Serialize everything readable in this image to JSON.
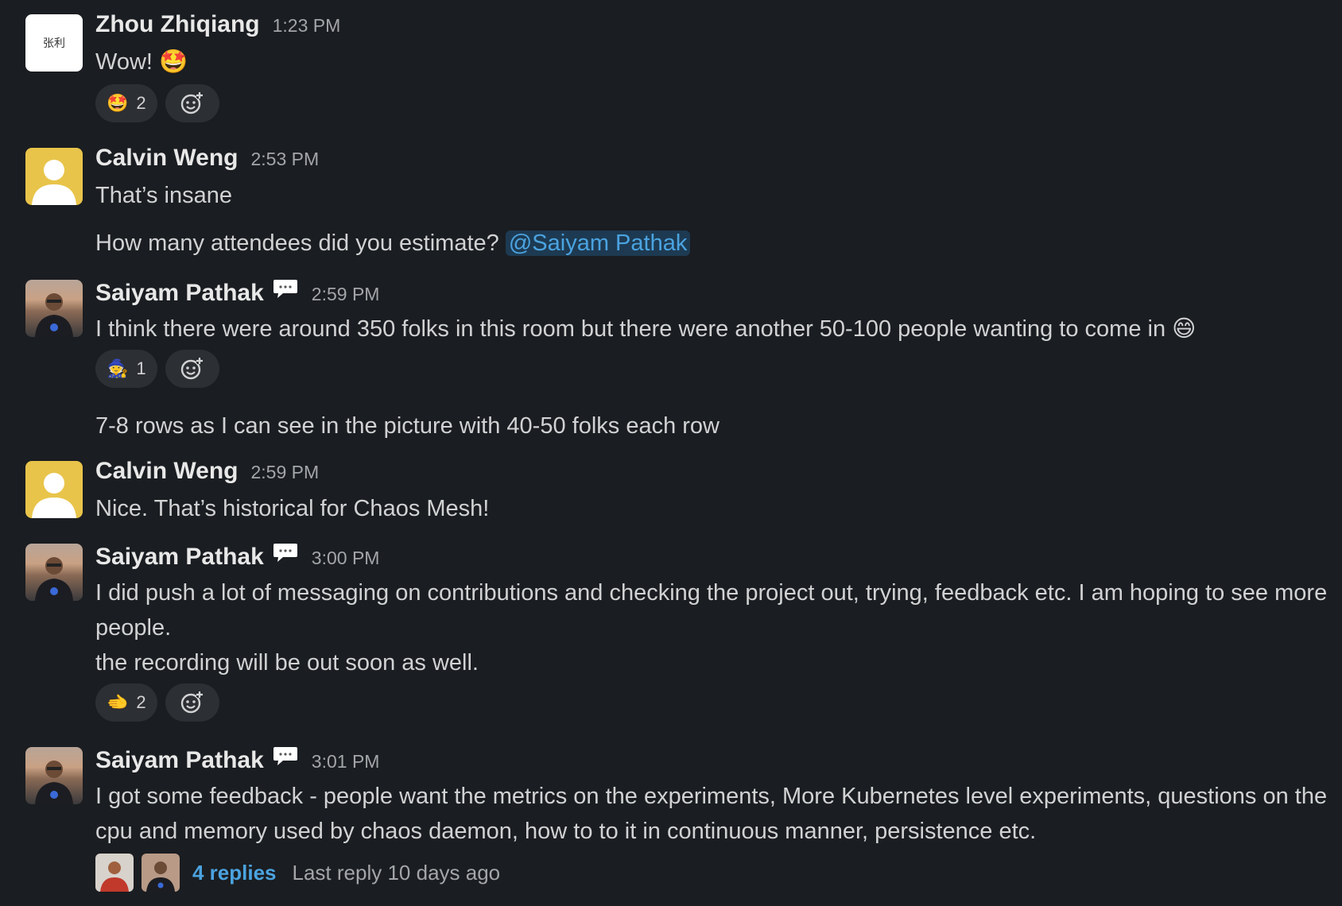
{
  "messages": [
    {
      "author": "Zhou Zhiqiang",
      "time": "1:23 PM",
      "text": "Wow! 🤩",
      "avatar_text": "张利",
      "reactions": [
        {
          "emoji": "🤩",
          "count": "2"
        }
      ]
    },
    {
      "author": "Calvin Weng",
      "time": "2:53 PM",
      "text": "That’s insane",
      "text2": "How many attendees did you estimate?",
      "mention": "@Saiyam Pathak"
    },
    {
      "author": "Saiyam Pathak",
      "time": "2:59 PM",
      "text": "I think there were around 350 folks in this room but there were another 50-100 people wanting to come in 😄",
      "reactions": [
        {
          "emoji": "🧙",
          "count": "1"
        }
      ],
      "text2": "7-8 rows as I can see in the picture with 40-50 folks each row"
    },
    {
      "author": "Calvin Weng",
      "time": "2:59 PM",
      "text": "Nice. That’s historical for Chaos Mesh!"
    },
    {
      "author": "Saiyam Pathak",
      "time": "3:00 PM",
      "text": "I did push a lot of messaging on contributions and checking the project out, trying, feedback etc. I am hoping to see more people.",
      "text2": "the recording will be out soon as well.",
      "reactions": [
        {
          "emoji": "🫲",
          "count": "2"
        }
      ]
    },
    {
      "author": "Saiyam Pathak",
      "time": "3:01 PM",
      "text": "I got some feedback - people want the metrics on the experiments, More Kubernetes level experiments, questions on the cpu and memory used by chaos daemon, how to to it in continuous manner, persistence etc.",
      "thread": {
        "replies": "4 replies",
        "last": "Last reply 10 days ago"
      }
    }
  ],
  "colors": {
    "background": "#1a1d21",
    "link": "#4ba3e0",
    "mention_bg": "#1d3a52",
    "pill": "#2c2f33"
  },
  "icons": [
    "add-reaction-icon",
    "speech-bubble-icon"
  ]
}
